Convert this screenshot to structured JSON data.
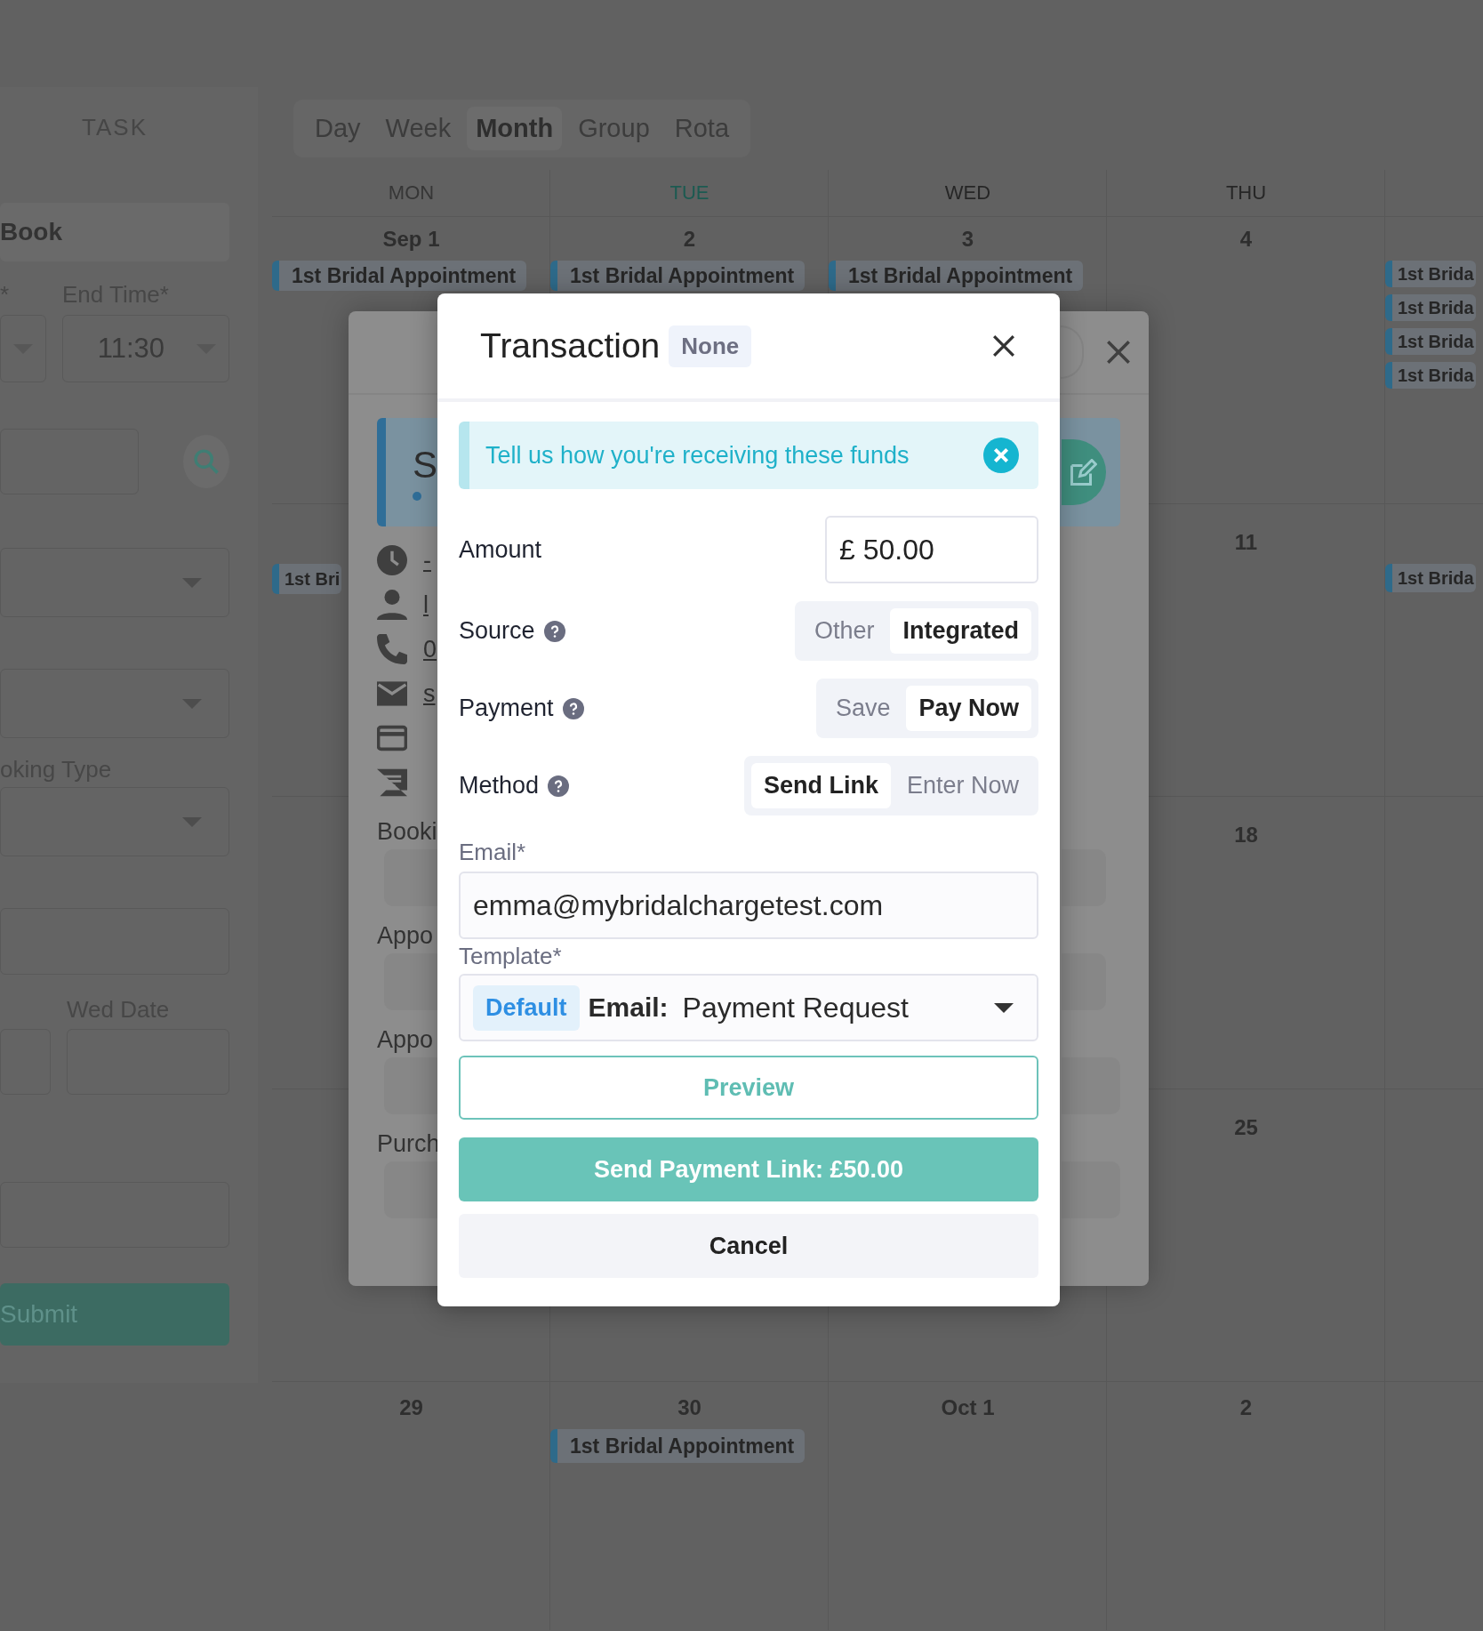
{
  "left_panel": {
    "title": "TASK",
    "book_label": "Book",
    "start_time_label": "*",
    "end_time_label": "End Time*",
    "end_time_value": "11:30",
    "booking_type_label": "oking Type",
    "wed_date_label": "Wed Date",
    "submit_button": "Submit"
  },
  "calendar": {
    "views": [
      {
        "label": "Day",
        "selected": false
      },
      {
        "label": "Week",
        "selected": false
      },
      {
        "label": "Month",
        "selected": true
      },
      {
        "label": "Group",
        "selected": false
      },
      {
        "label": "Rota",
        "selected": false
      }
    ],
    "weekdays": [
      {
        "label": "MON",
        "kind": "past"
      },
      {
        "label": "TUE",
        "kind": "today"
      },
      {
        "label": "WED",
        "kind": "normal"
      },
      {
        "label": "THU",
        "kind": "normal"
      }
    ],
    "weeks": [
      {
        "cells": [
          {
            "date": "Sep 1",
            "events": [
              "1st Bridal Appointment"
            ]
          },
          {
            "date": "2",
            "events": [
              "1st Bridal Appointment"
            ]
          },
          {
            "date": "3",
            "events": [
              "1st Bridal Appointment"
            ]
          },
          {
            "date": "4"
          },
          {
            "events": [
              "1st Brida",
              "1st Brida",
              "1st Brida",
              "1st Brida"
            ]
          }
        ]
      },
      {
        "cells": [
          {
            "events": [
              "1st Bri"
            ]
          },
          {},
          {},
          {
            "date": "11"
          },
          {
            "events": [
              "1st Brida"
            ]
          }
        ]
      },
      {
        "cells": [
          {},
          {},
          {},
          {
            "date": "18"
          },
          {}
        ]
      },
      {
        "cells": [
          {},
          {},
          {},
          {
            "date": "25"
          },
          {}
        ]
      },
      {
        "cells": [
          {
            "date": "29"
          },
          {
            "date": "30",
            "events": [
              "1st Bridal Appointment"
            ]
          },
          {
            "date": "Oct 1"
          },
          {
            "date": "2"
          },
          {}
        ]
      }
    ]
  },
  "booking_modal": {
    "title_initial": "S",
    "details": [
      "-",
      "l",
      "0",
      "s"
    ],
    "field_labels": [
      "Booki",
      "Appo",
      "Appo",
      "Purch"
    ]
  },
  "transaction_modal": {
    "title": "Transaction",
    "status_badge": "None",
    "alert": "Tell us how you're receiving these funds",
    "rows": [
      {
        "kind": "amount",
        "label": "Amount",
        "value": "£ 50.00"
      },
      {
        "kind": "toggle",
        "label": "Source",
        "help": true,
        "options": [
          {
            "label": "Other",
            "selected": false
          },
          {
            "label": "Integrated",
            "selected": true
          }
        ]
      },
      {
        "kind": "toggle",
        "label": "Payment",
        "help": true,
        "options": [
          {
            "label": "Save",
            "selected": false
          },
          {
            "label": "Pay Now",
            "selected": true
          }
        ]
      },
      {
        "kind": "toggle",
        "label": "Method",
        "help": true,
        "options": [
          {
            "label": "Send Link",
            "selected": true
          },
          {
            "label": "Enter Now",
            "selected": false
          }
        ]
      }
    ],
    "email": {
      "label": "Email*",
      "value": "emma@mybridalchargetest.com"
    },
    "template": {
      "label": "Template*",
      "badge": "Default",
      "prefix": "Email:",
      "value": "Payment Request"
    },
    "buttons": [
      {
        "kind": "outline",
        "label": "Preview"
      },
      {
        "kind": "primary",
        "label": "Send Payment Link: £50.00"
      },
      {
        "kind": "secondary",
        "label": "Cancel"
      }
    ]
  }
}
